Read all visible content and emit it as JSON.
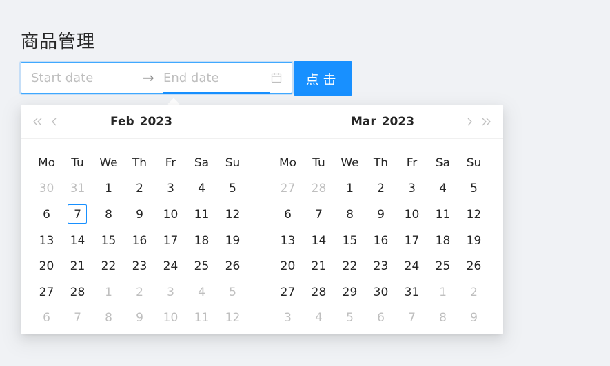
{
  "page": {
    "title": "商品管理"
  },
  "range_picker": {
    "start_placeholder": "Start date",
    "end_placeholder": "End date",
    "separator": "→",
    "accent": "#1890ff",
    "icon": "calendar-icon"
  },
  "submit_button": {
    "label": "点击",
    "color": "#1890ff"
  },
  "calendar": {
    "weekdays": [
      "Mo",
      "Tu",
      "We",
      "Th",
      "Fr",
      "Sa",
      "Su"
    ],
    "nav_icons": [
      "double-left-icon",
      "left-icon",
      "right-icon",
      "double-right-icon"
    ],
    "left": {
      "month": "Feb",
      "year": "2023",
      "weeks": [
        [
          {
            "d": "30",
            "m": true
          },
          {
            "d": "31",
            "m": true
          },
          {
            "d": "1"
          },
          {
            "d": "2"
          },
          {
            "d": "3"
          },
          {
            "d": "4"
          },
          {
            "d": "5"
          }
        ],
        [
          {
            "d": "6"
          },
          {
            "d": "7",
            "today": true
          },
          {
            "d": "8"
          },
          {
            "d": "9"
          },
          {
            "d": "10"
          },
          {
            "d": "11"
          },
          {
            "d": "12"
          }
        ],
        [
          {
            "d": "13"
          },
          {
            "d": "14"
          },
          {
            "d": "15"
          },
          {
            "d": "16"
          },
          {
            "d": "17"
          },
          {
            "d": "18"
          },
          {
            "d": "19"
          }
        ],
        [
          {
            "d": "20"
          },
          {
            "d": "21"
          },
          {
            "d": "22"
          },
          {
            "d": "23"
          },
          {
            "d": "24"
          },
          {
            "d": "25"
          },
          {
            "d": "26"
          }
        ],
        [
          {
            "d": "27"
          },
          {
            "d": "28"
          },
          {
            "d": "1",
            "m": true
          },
          {
            "d": "2",
            "m": true
          },
          {
            "d": "3",
            "m": true
          },
          {
            "d": "4",
            "m": true
          },
          {
            "d": "5",
            "m": true
          }
        ],
        [
          {
            "d": "6",
            "m": true
          },
          {
            "d": "7",
            "m": true
          },
          {
            "d": "8",
            "m": true
          },
          {
            "d": "9",
            "m": true
          },
          {
            "d": "10",
            "m": true
          },
          {
            "d": "11",
            "m": true
          },
          {
            "d": "12",
            "m": true
          }
        ]
      ]
    },
    "right": {
      "month": "Mar",
      "year": "2023",
      "weeks": [
        [
          {
            "d": "27",
            "m": true
          },
          {
            "d": "28",
            "m": true
          },
          {
            "d": "1"
          },
          {
            "d": "2"
          },
          {
            "d": "3"
          },
          {
            "d": "4"
          },
          {
            "d": "5"
          }
        ],
        [
          {
            "d": "6"
          },
          {
            "d": "7"
          },
          {
            "d": "8"
          },
          {
            "d": "9"
          },
          {
            "d": "10"
          },
          {
            "d": "11"
          },
          {
            "d": "12"
          }
        ],
        [
          {
            "d": "13"
          },
          {
            "d": "14"
          },
          {
            "d": "15"
          },
          {
            "d": "16"
          },
          {
            "d": "17"
          },
          {
            "d": "18"
          },
          {
            "d": "19"
          }
        ],
        [
          {
            "d": "20"
          },
          {
            "d": "21"
          },
          {
            "d": "22"
          },
          {
            "d": "23"
          },
          {
            "d": "24"
          },
          {
            "d": "25"
          },
          {
            "d": "26"
          }
        ],
        [
          {
            "d": "27"
          },
          {
            "d": "28"
          },
          {
            "d": "29"
          },
          {
            "d": "30"
          },
          {
            "d": "31"
          },
          {
            "d": "1",
            "m": true
          },
          {
            "d": "2",
            "m": true
          }
        ],
        [
          {
            "d": "3",
            "m": true
          },
          {
            "d": "4",
            "m": true
          },
          {
            "d": "5",
            "m": true
          },
          {
            "d": "6",
            "m": true
          },
          {
            "d": "7",
            "m": true
          },
          {
            "d": "8",
            "m": true
          },
          {
            "d": "9",
            "m": true
          }
        ]
      ]
    }
  }
}
